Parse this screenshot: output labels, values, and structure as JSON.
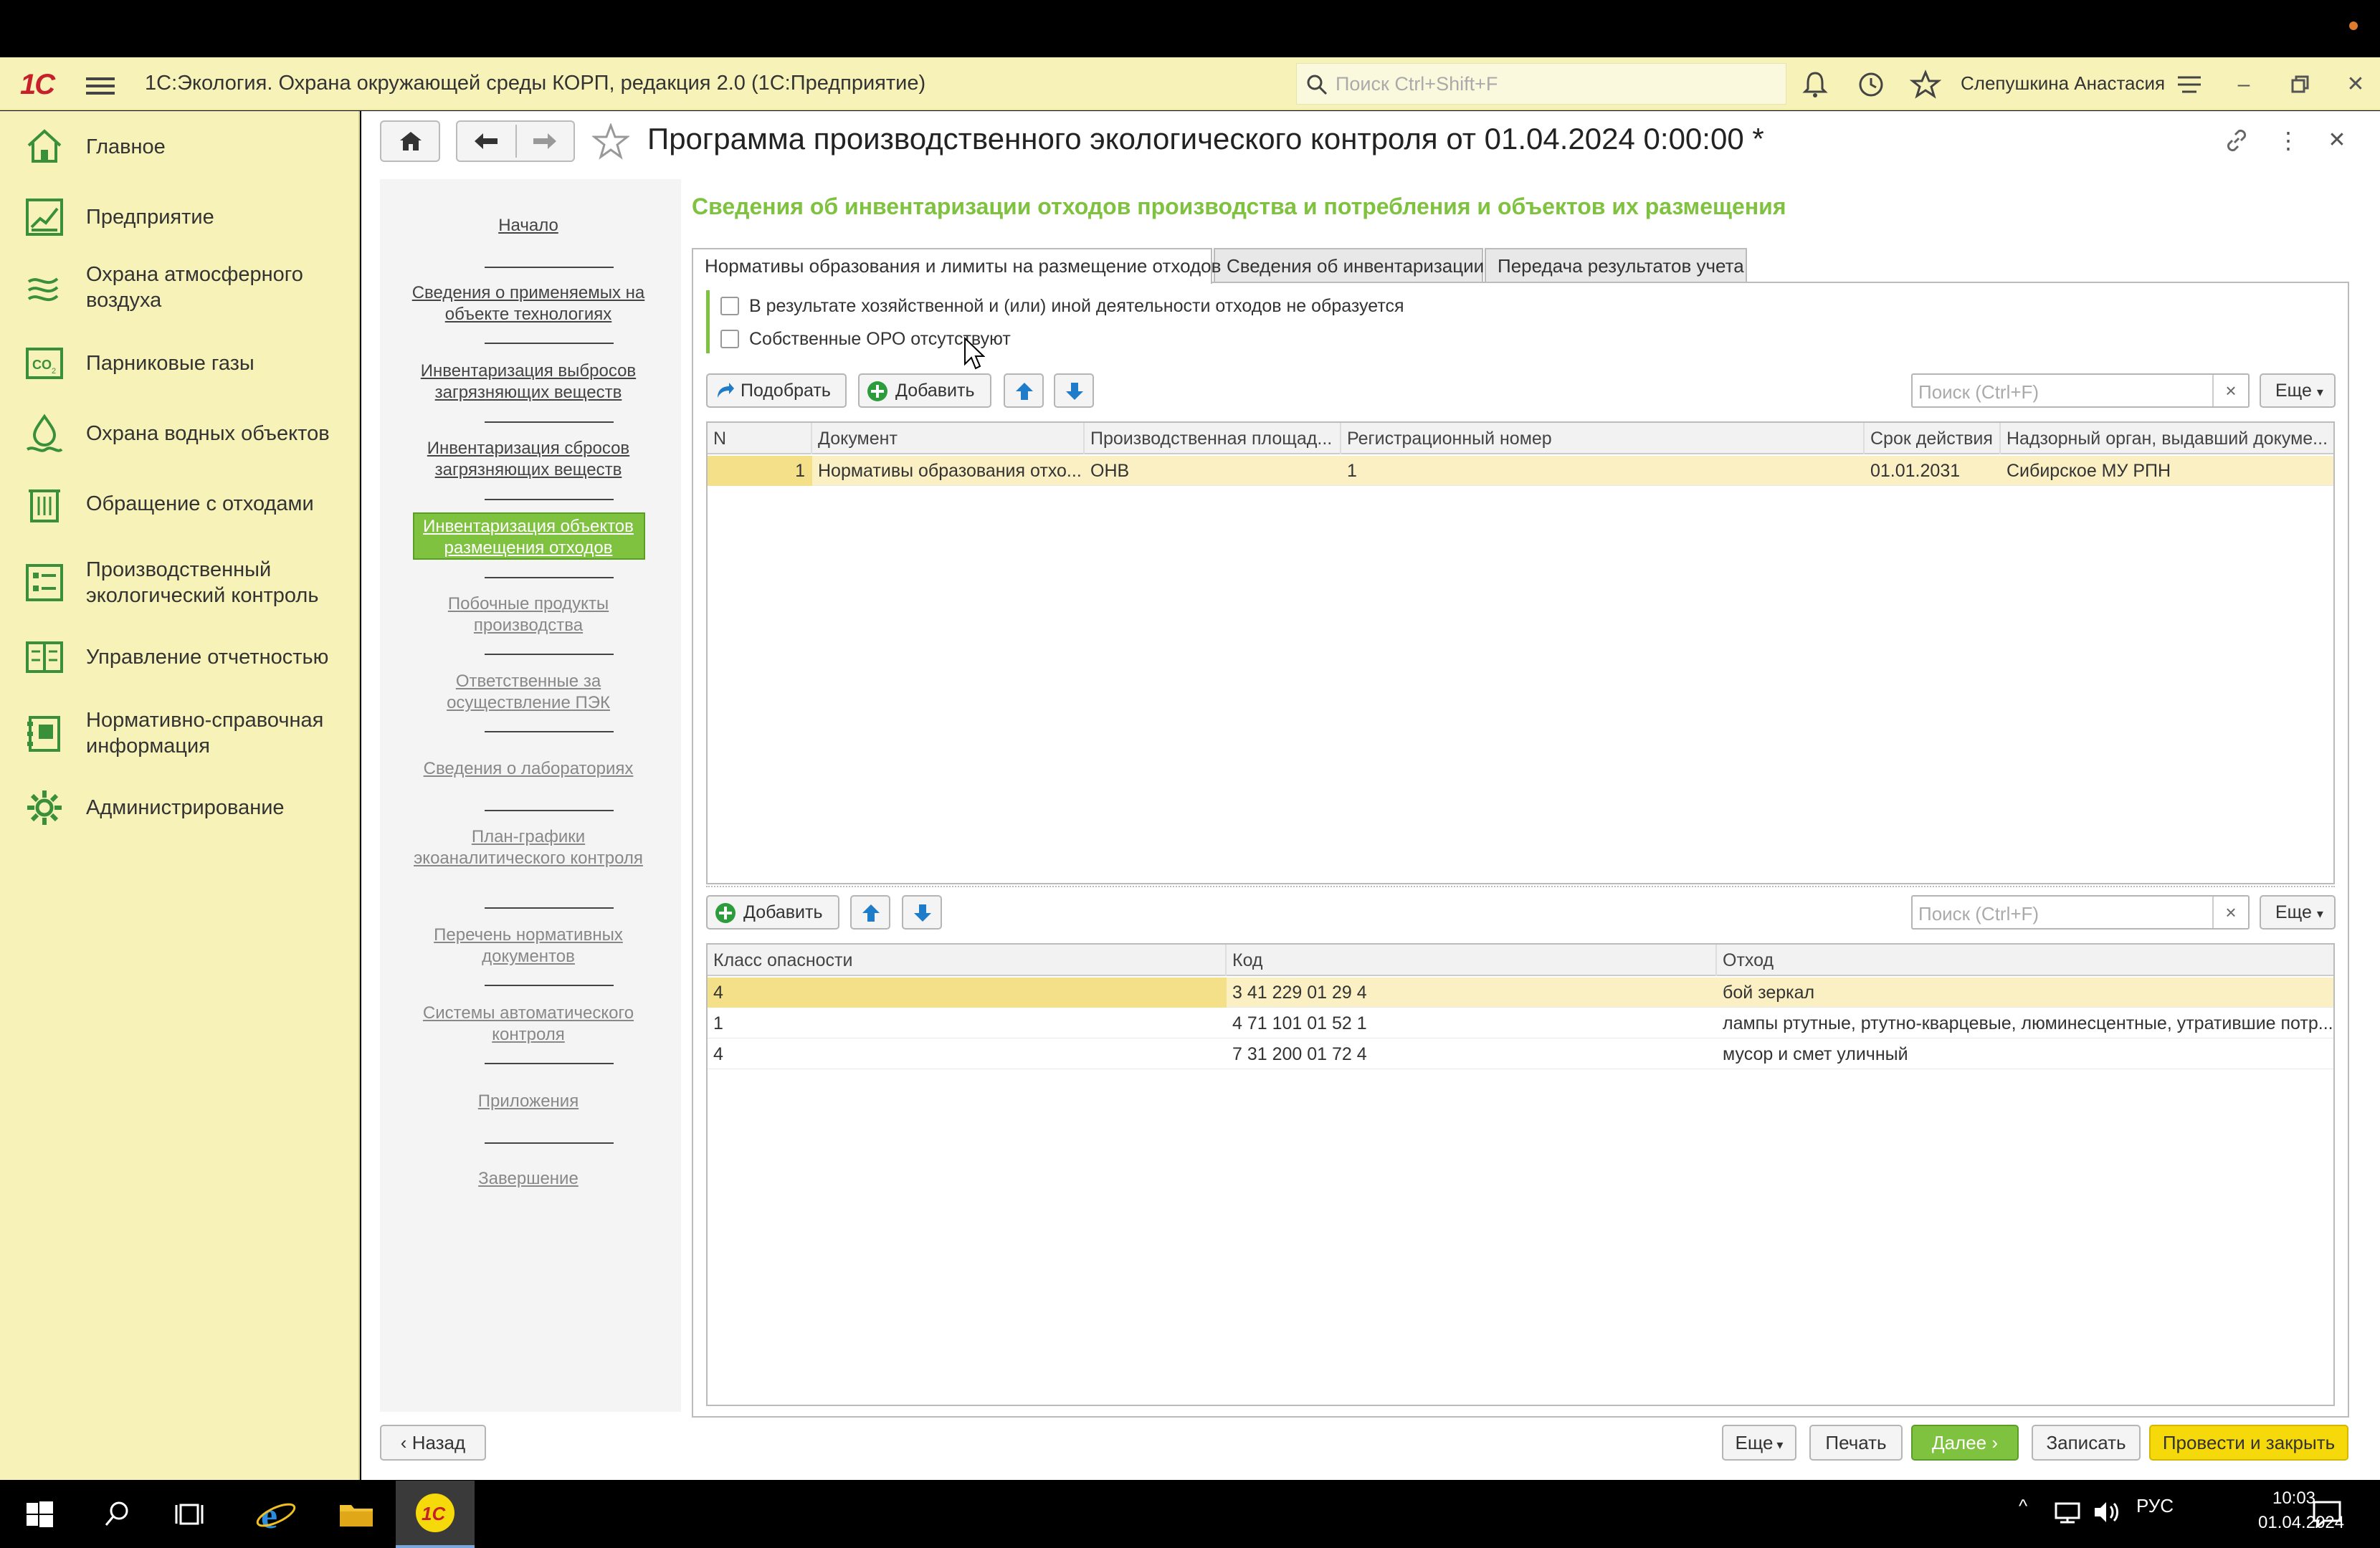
{
  "app": {
    "logo": "1С",
    "title": "1С:Экология. Охрана окружающей среды КОРП, редакция 2.0  (1С:Предприятие)",
    "search_placeholder": "Поиск Ctrl+Shift+F",
    "user": "Слепушкина Анастасия"
  },
  "sidebar": {
    "items": [
      {
        "label": "Главное",
        "icon": "home-icon"
      },
      {
        "label": "Предприятие",
        "icon": "chart-icon"
      },
      {
        "label": "Охрана атмосферного воздуха",
        "icon": "air-icon"
      },
      {
        "label": "Парниковые газы",
        "icon": "co2-icon"
      },
      {
        "label": "Охрана водных объектов",
        "icon": "water-icon"
      },
      {
        "label": "Обращение с отходами",
        "icon": "waste-icon"
      },
      {
        "label": "Производственный экологический контроль",
        "icon": "control-icon"
      },
      {
        "label": "Управление отчетностью",
        "icon": "report-icon"
      },
      {
        "label": "Нормативно-справочная информация",
        "icon": "reference-icon"
      },
      {
        "label": "Администрирование",
        "icon": "gear-icon"
      }
    ]
  },
  "document": {
    "title": "Программа производственного экологического контроля  от 01.04.2024 0:00:00 *",
    "section_title": "Сведения об инвентаризации отходов производства и потребления и объектов их размещения"
  },
  "nav": {
    "links": [
      "Начало",
      "Сведения о применяемых на объекте технологиях",
      "Инвентаризация выбросов загрязняющих веществ",
      "Инвентаризация сбросов загрязняющих веществ",
      "Инвентаризация объектов размещения отходов",
      "Побочные продукты производства",
      "Ответственные за осуществление ПЭК",
      "Сведения о лабораториях",
      "План-графики экоаналитического контроля",
      "Перечень нормативных документов",
      "Системы автоматического контроля",
      "Приложения",
      "Завершение"
    ]
  },
  "tabs": [
    "Нормативы образования и лимиты на размещение отходов",
    "Сведения об инвентаризации",
    "Передача результатов учета"
  ],
  "checkboxes": [
    "В результате хозяйственной и (или) иной деятельности отходов не образуется",
    "Собственные ОРО отсутствуют"
  ],
  "toolbar1": {
    "pick": "Подобрать",
    "add": "Добавить",
    "search_placeholder": "Поиск (Ctrl+F)",
    "more": "Еще"
  },
  "table1": {
    "headers": [
      "N",
      "Документ",
      "Производственная площад...",
      "Регистрационный номер",
      "Срок действия",
      "Надзорный орган, выдавший докуме..."
    ],
    "rows": [
      [
        "1",
        "Нормативы образования отхо...",
        "ОНВ",
        "1",
        "01.01.2031",
        "Сибирское МУ РПН"
      ]
    ]
  },
  "toolbar2": {
    "add": "Добавить",
    "search_placeholder": "Поиск (Ctrl+F)",
    "more": "Еще"
  },
  "table2": {
    "headers": [
      "Класс опасности",
      "Код",
      "Отход"
    ],
    "rows": [
      [
        "4",
        "3 41 229 01 29 4",
        "бой зеркал"
      ],
      [
        "1",
        "4 71 101 01 52 1",
        "лампы ртутные, ртутно-кварцевые, люминесцентные, утратившие потр..."
      ],
      [
        "4",
        "7 31 200 01 72 4",
        "мусор и смет уличный"
      ]
    ]
  },
  "bottom": {
    "back": "Назад",
    "more": "Еще",
    "print": "Печать",
    "next": "Далее",
    "save": "Записать",
    "post_close": "Провести и закрыть"
  },
  "taskbar": {
    "lang": "РУС",
    "time": "10:03",
    "date": "01.04.2024"
  },
  "colors": {
    "accent_green": "#7fc23f",
    "sidebar_bg": "#f7f3b8",
    "selected_row": "#fbf0c4",
    "primary_button": "#f5d90a"
  }
}
